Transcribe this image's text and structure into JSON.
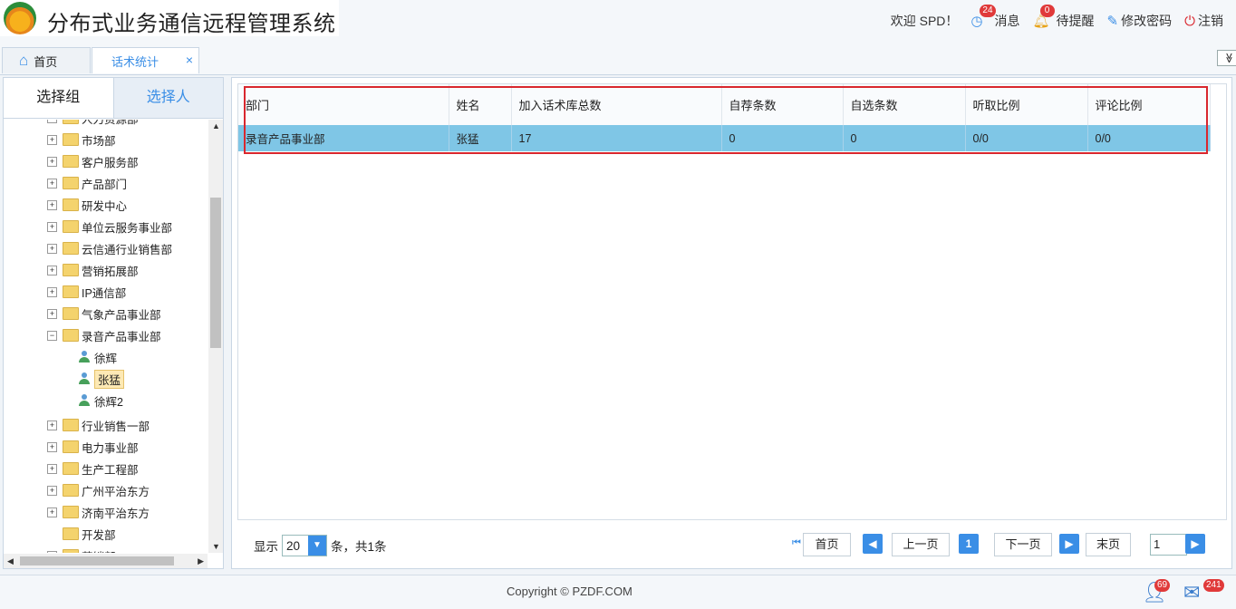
{
  "header": {
    "app_title": "分布式业务通信远程管理系统",
    "welcome": "欢迎 SPD！",
    "messages_label": "消息",
    "messages_count": "24",
    "reminders_label": "待提醒",
    "reminders_count": "0",
    "change_password_label": "修改密码",
    "logout_label": "注销"
  },
  "tabs": {
    "home_label": "首页",
    "active_label": "话术统计",
    "close_glyph": "×",
    "collapse_glyph": "≫"
  },
  "left": {
    "tab_group": "选择组",
    "tab_person": "选择人",
    "tree": [
      {
        "label": "人力资源部",
        "type": "folder"
      },
      {
        "label": "市场部",
        "type": "folder"
      },
      {
        "label": "客户服务部",
        "type": "folder"
      },
      {
        "label": "产品部门",
        "type": "folder"
      },
      {
        "label": "研发中心",
        "type": "folder"
      },
      {
        "label": "单位云服务事业部",
        "type": "folder"
      },
      {
        "label": "云信通行业销售部",
        "type": "folder"
      },
      {
        "label": "营销拓展部",
        "type": "folder"
      },
      {
        "label": "IP通信部",
        "type": "folder"
      },
      {
        "label": "气象产品事业部",
        "type": "folder"
      },
      {
        "label": "录音产品事业部",
        "type": "folder-open"
      },
      {
        "label": "徐辉",
        "type": "person"
      },
      {
        "label": "张猛",
        "type": "person-selected"
      },
      {
        "label": "徐辉2",
        "type": "person"
      },
      {
        "label": "行业销售一部",
        "type": "folder"
      },
      {
        "label": "电力事业部",
        "type": "folder"
      },
      {
        "label": "生产工程部",
        "type": "folder"
      },
      {
        "label": "广州平治东方",
        "type": "folder"
      },
      {
        "label": "济南平治东方",
        "type": "folder"
      },
      {
        "label": "开发部",
        "type": "folder-leaf"
      },
      {
        "label": "营销部",
        "type": "folder"
      }
    ]
  },
  "table": {
    "headers": [
      "部门",
      "姓名",
      "加入话术库总数",
      "自荐条数",
      "自选条数",
      "听取比例",
      "评论比例"
    ],
    "rows": [
      [
        "录音产品事业部",
        "张猛",
        "17",
        "0",
        "0",
        "0/0",
        "0/0"
      ]
    ]
  },
  "pager": {
    "show_label": "显示",
    "page_size": "20",
    "summary": "条，共1条",
    "first": "首页",
    "prev": "上一页",
    "current": "1",
    "next": "下一页",
    "last": "末页",
    "goto_value": "1"
  },
  "footer": {
    "copyright": "Copyright © PZDF.COM",
    "user_badge": "69",
    "mail_badge": "241"
  },
  "colors": {
    "accent": "#3a8ee6",
    "selected_row": "#7fc6e6",
    "highlight_border": "#d9272e"
  }
}
